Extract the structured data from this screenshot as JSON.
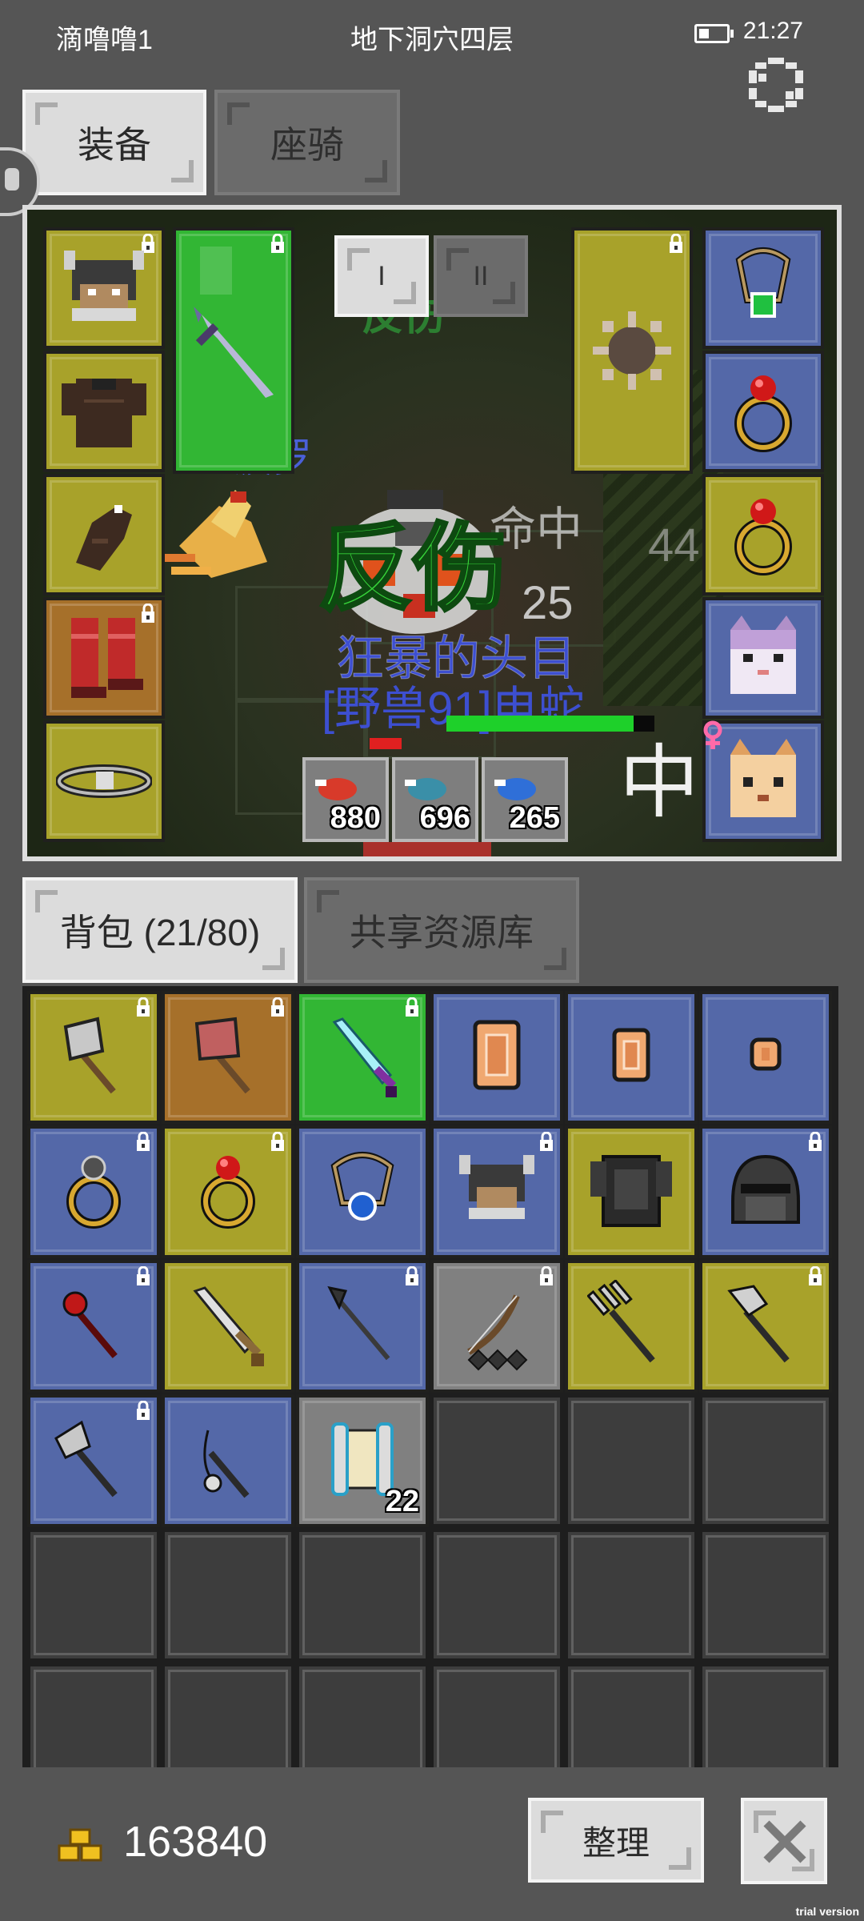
{
  "status_bar": {
    "player_name": "滴噜噜1",
    "location": "地下洞穴四层",
    "time": "21:27"
  },
  "top_tabs": [
    {
      "label": "装备",
      "active": true
    },
    {
      "label": "座骑",
      "active": false
    }
  ],
  "equip_pages": [
    "I",
    "II"
  ],
  "battle_text": {
    "counter_damage": "反伤",
    "counter_damage_faded": "反伤",
    "hit": "命中",
    "number_25": "25",
    "number_44": "44",
    "boss_name": "狂暴的头目",
    "boss_type": "[野兽91]电蛇",
    "ally_name": "波罗",
    "hit_faded": "中"
  },
  "potions": [
    {
      "color": "#d83a2a",
      "count": "880"
    },
    {
      "color": "#3a8fa8",
      "count": "696"
    },
    {
      "color": "#2f6fd8",
      "count": "265"
    }
  ],
  "bottom_tabs": [
    {
      "label": "背包 (21/80)",
      "active": true
    },
    {
      "label": "共享资源库",
      "active": false
    }
  ],
  "inventory": {
    "rows": [
      [
        {
          "item": "axe-icon",
          "rarity": "yellow",
          "locked": true
        },
        {
          "item": "red-axe-icon",
          "rarity": "orange",
          "locked": true
        },
        {
          "item": "cyan-sword-icon",
          "rarity": "green",
          "locked": true
        },
        {
          "item": "large-rune-icon",
          "rarity": "blue",
          "locked": false
        },
        {
          "item": "medium-rune-icon",
          "rarity": "blue",
          "locked": false
        },
        {
          "item": "small-rune-icon",
          "rarity": "blue",
          "locked": false
        }
      ],
      [
        {
          "item": "silver-ring-icon",
          "rarity": "blue",
          "locked": true
        },
        {
          "item": "ruby-ring-icon",
          "rarity": "yellow",
          "locked": true
        },
        {
          "item": "sapphire-necklace-icon",
          "rarity": "blue",
          "locked": false
        },
        {
          "item": "horned-helmet-icon",
          "rarity": "blue",
          "locked": true
        },
        {
          "item": "dark-armor-icon",
          "rarity": "yellow",
          "locked": false
        },
        {
          "item": "steel-helmet-icon",
          "rarity": "blue",
          "locked": true
        }
      ],
      [
        {
          "item": "red-wand-icon",
          "rarity": "blue",
          "locked": true
        },
        {
          "item": "broadsword-icon",
          "rarity": "yellow",
          "locked": false
        },
        {
          "item": "spear-icon",
          "rarity": "blue",
          "locked": true
        },
        {
          "item": "bow-icon",
          "rarity": "gray",
          "locked": true
        },
        {
          "item": "trident-icon",
          "rarity": "yellow",
          "locked": false
        },
        {
          "item": "halberd-icon",
          "rarity": "yellow",
          "locked": true
        }
      ],
      [
        {
          "item": "poleaxe-icon",
          "rarity": "blue",
          "locked": true
        },
        {
          "item": "flail-icon",
          "rarity": "blue",
          "locked": false
        },
        {
          "item": "scroll-icon",
          "rarity": "gray",
          "locked": false,
          "quantity": "22"
        },
        {
          "item": "",
          "rarity": "empty",
          "locked": false
        },
        {
          "item": "",
          "rarity": "empty",
          "locked": false
        },
        {
          "item": "",
          "rarity": "empty",
          "locked": false
        }
      ],
      [
        {
          "item": "",
          "rarity": "empty"
        },
        {
          "item": "",
          "rarity": "empty"
        },
        {
          "item": "",
          "rarity": "empty"
        },
        {
          "item": "",
          "rarity": "empty"
        },
        {
          "item": "",
          "rarity": "empty"
        },
        {
          "item": "",
          "rarity": "empty"
        }
      ],
      [
        {
          "item": "",
          "rarity": "empty"
        },
        {
          "item": "",
          "rarity": "empty"
        },
        {
          "item": "",
          "rarity": "empty"
        },
        {
          "item": "",
          "rarity": "empty"
        },
        {
          "item": "",
          "rarity": "empty"
        },
        {
          "item": "",
          "rarity": "empty"
        }
      ]
    ]
  },
  "equipment": {
    "left_column": [
      {
        "item": "horned-helmet-icon",
        "rarity": "yellow",
        "locked": true
      },
      {
        "item": "leather-armor-icon",
        "rarity": "yellow",
        "locked": false
      },
      {
        "item": "glove-icon",
        "rarity": "yellow",
        "locked": false
      },
      {
        "item": "red-boots-icon",
        "rarity": "orange",
        "locked": true
      },
      {
        "item": "belt-icon",
        "rarity": "yellow",
        "locked": false
      }
    ],
    "weapon": {
      "item": "dagger-icon",
      "rarity": "green",
      "locked": true
    },
    "offhand": {
      "item": "spiked-mace-icon",
      "rarity": "yellow",
      "locked": true
    },
    "right_column": [
      {
        "item": "emerald-necklace-icon",
        "rarity": "blue",
        "locked": false
      },
      {
        "item": "ruby-ring-icon",
        "rarity": "blue",
        "locked": false
      },
      {
        "item": "ruby-ring-icon",
        "rarity": "yellow",
        "locked": false
      },
      {
        "item": "cat-pet-icon",
        "rarity": "blue",
        "locked": false
      },
      {
        "item": "fox-pet-icon",
        "rarity": "blue",
        "locked": false
      }
    ]
  },
  "footer": {
    "gold_amount": "163840",
    "sort_label": "整理",
    "watermark": "trial version"
  },
  "colors": {
    "background": "#555555",
    "rarity_yellow": "#a8a22a",
    "rarity_blue": "#5468a8",
    "rarity_green": "#32b634",
    "rarity_orange": "#a6702a",
    "rarity_gray": "#808080",
    "counter_damage_text": "#37d43a",
    "boss_text": "#3d4fd0"
  }
}
